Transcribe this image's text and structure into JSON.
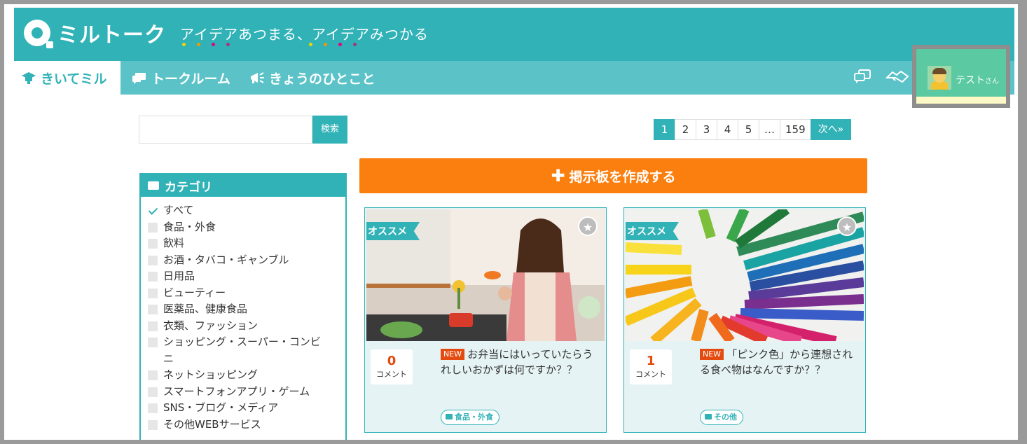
{
  "header": {
    "logo_text": "ミルトーク",
    "tagline": "アイデアあつまる、アイデアみつかる",
    "dot_colors": [
      "#f2d400",
      "#f39800",
      "#e4007f",
      "#a3367e"
    ]
  },
  "nav": {
    "items": [
      {
        "label": "きいてミル",
        "icon": "graduation-cap-icon",
        "active": true
      },
      {
        "label": "トークルーム",
        "icon": "chat-bubble-icon",
        "active": false
      },
      {
        "label": "きょうのひとこと",
        "icon": "megaphone-icon",
        "active": false
      }
    ],
    "right_icons": [
      "messages-icon",
      "handshake-icon"
    ]
  },
  "user": {
    "name": "テスト",
    "suffix": "さん"
  },
  "search": {
    "value": "",
    "button_label": "検索"
  },
  "pagination": {
    "pages": [
      "1",
      "2",
      "3",
      "4",
      "5",
      "…",
      "159"
    ],
    "current": "1",
    "next_label": "次へ»"
  },
  "create_button": {
    "label": "掲示板を作成する"
  },
  "categories": {
    "title": "カテゴリ",
    "items": [
      {
        "label": "すべて",
        "checked": true
      },
      {
        "label": "食品・外食",
        "checked": false
      },
      {
        "label": "飲料",
        "checked": false
      },
      {
        "label": "お酒・タバコ・ギャンブル",
        "checked": false
      },
      {
        "label": "日用品",
        "checked": false
      },
      {
        "label": "ビューティー",
        "checked": false
      },
      {
        "label": "医薬品、健康食品",
        "checked": false
      },
      {
        "label": "衣類、ファッション",
        "checked": false
      },
      {
        "label": "ショッピング・スーパー・コンビニ",
        "checked": false
      },
      {
        "label": "ネットショッピング",
        "checked": false
      },
      {
        "label": "スマートフォンアプリ・ゲーム",
        "checked": false
      },
      {
        "label": "SNS・ブログ・メディア",
        "checked": false
      },
      {
        "label": "その他WEBサービス",
        "checked": false
      }
    ]
  },
  "cards": [
    {
      "ribbon": "オススメ",
      "comment_count": "0",
      "comment_label": "コメント",
      "new_badge": "NEW",
      "title": "お弁当にはいっていたらうれしいおかずは何ですか？？",
      "tag": "食品・外食"
    },
    {
      "ribbon": "オススメ",
      "comment_count": "1",
      "comment_label": "コメント",
      "new_badge": "NEW",
      "title": "「ピンク色」から連想される食べ物はなんですか？？",
      "tag": "その他"
    }
  ]
}
